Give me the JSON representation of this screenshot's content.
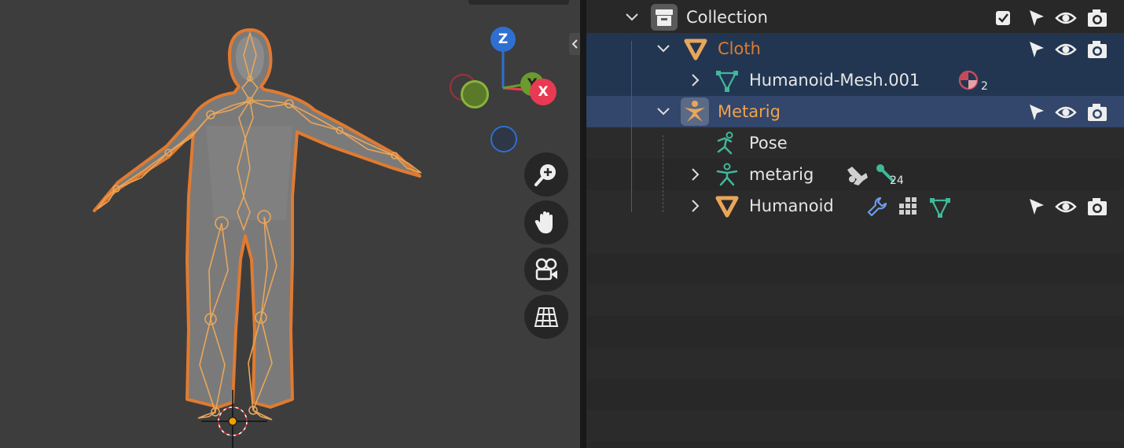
{
  "viewport": {
    "gizmo": {
      "z_label": "Z",
      "y_label": "Y",
      "x_label": "X"
    },
    "colors": {
      "selection_outline": "#e07b31",
      "bone": "#e8a65a",
      "x_axis": "#e83a53",
      "y_axis": "#6b9a2e",
      "z_axis": "#2e6fd1"
    },
    "nav_buttons": [
      "zoom-icon",
      "pan-hand-icon",
      "camera-icon",
      "grid-perspective-icon"
    ]
  },
  "outliner": {
    "rows": [
      {
        "label": "Collection",
        "icon": "collection-icon"
      },
      {
        "label": "Cloth",
        "icon": "mesh-object-icon"
      },
      {
        "label": "Humanoid-Mesh.001",
        "icon": "mesh-data-icon",
        "badge_count": "2"
      },
      {
        "label": "Metarig",
        "icon": "armature-object-icon"
      },
      {
        "label": "Pose",
        "icon": "pose-icon"
      },
      {
        "label": "metarig",
        "icon": "armature-data-icon",
        "badge_count": "24"
      },
      {
        "label": "Humanoid",
        "icon": "mesh-object-icon"
      }
    ]
  }
}
